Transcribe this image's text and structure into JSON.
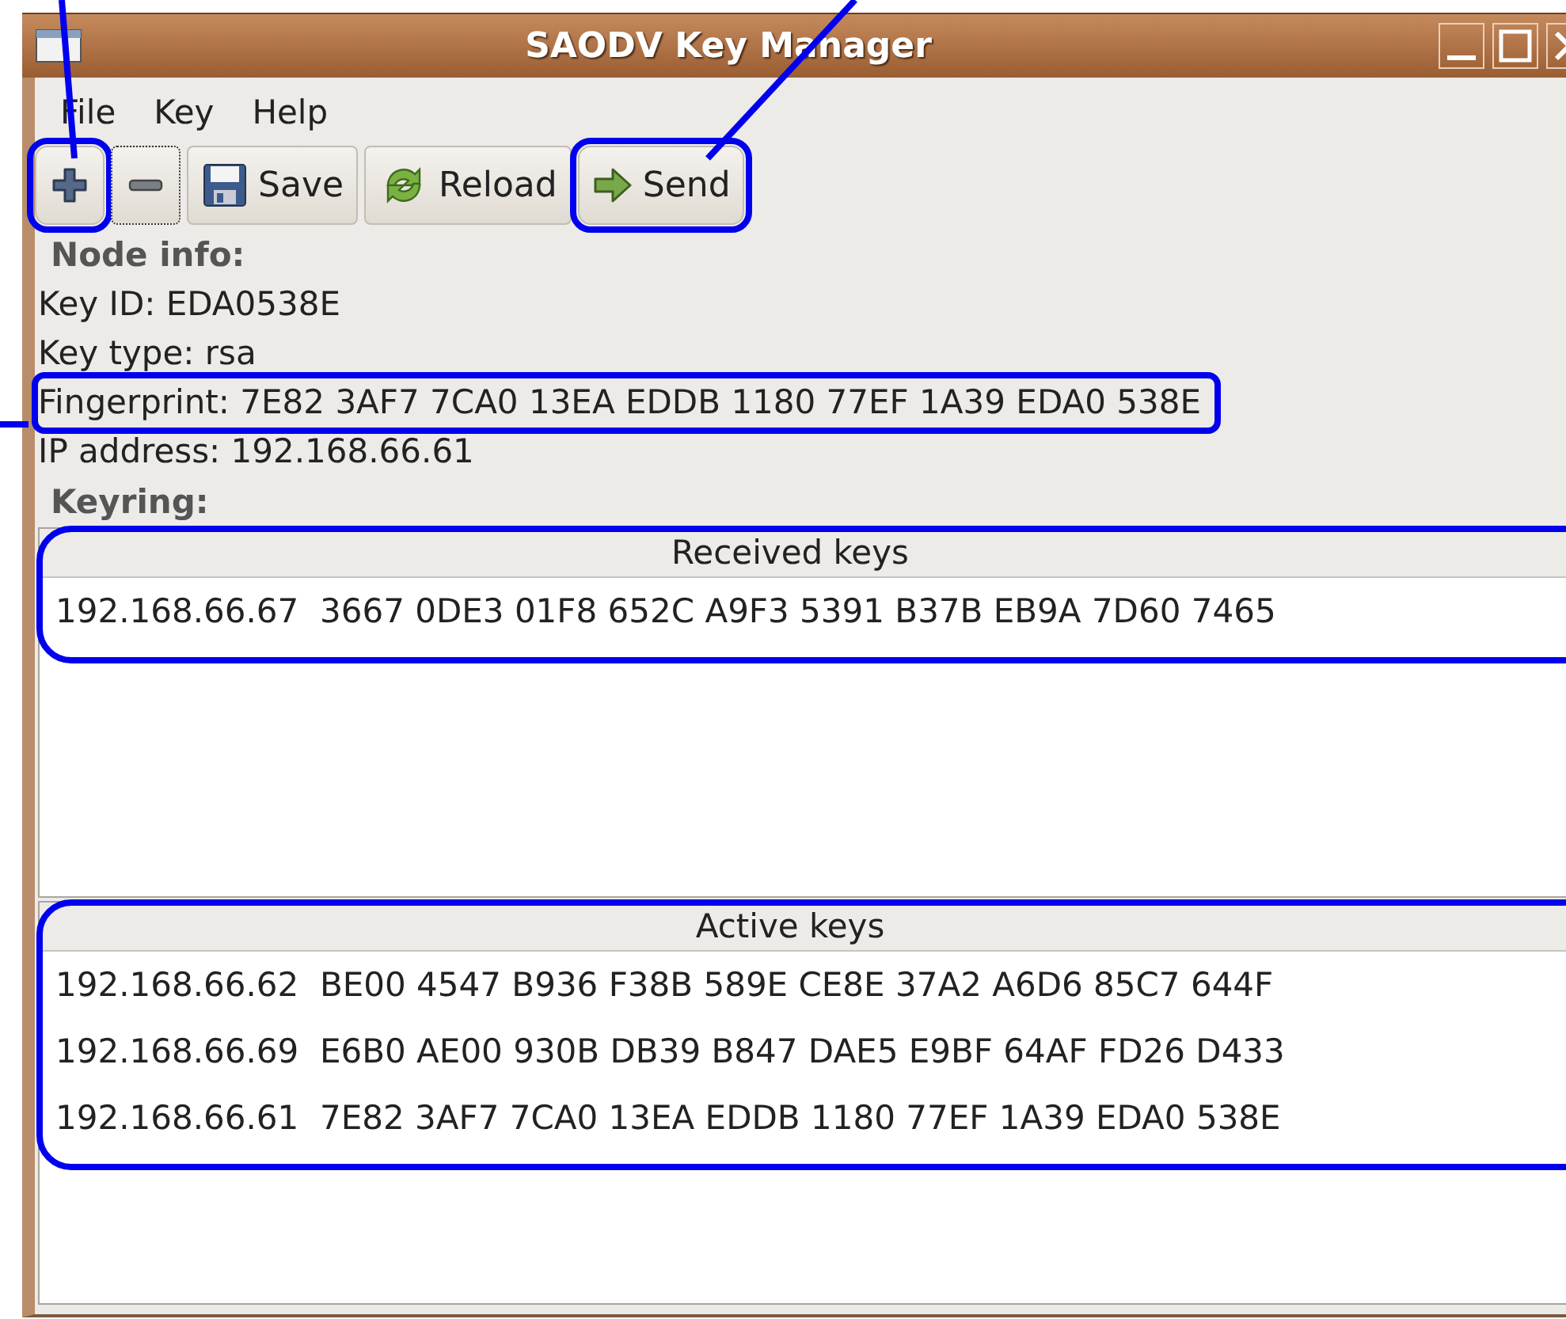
{
  "window": {
    "title": "SAODV Key Manager"
  },
  "menu": [
    {
      "label": "File"
    },
    {
      "label": "Key"
    },
    {
      "label": "Help"
    }
  ],
  "toolbar": [
    {
      "kind": "add",
      "highlighted": true,
      "focused": false
    },
    {
      "kind": "remove",
      "highlighted": false,
      "focused": true
    },
    {
      "kind": "save",
      "label": "Save",
      "highlighted": false,
      "focused": false
    },
    {
      "kind": "reload",
      "label": "Reload",
      "highlighted": false,
      "focused": false
    },
    {
      "kind": "send",
      "label": "Send",
      "highlighted": true,
      "focused": false
    }
  ],
  "node_info": {
    "heading": "Node info:",
    "lines": [
      {
        "text": "Key ID: EDA0538E",
        "highlighted": false
      },
      {
        "text": "Key type: rsa",
        "highlighted": false
      },
      {
        "text": "Fingerprint: 7E82 3AF7 7CA0 13EA EDDB 1180 77EF 1A39 EDA0 538E",
        "highlighted": true
      },
      {
        "text": "IP address: 192.168.66.61",
        "highlighted": false
      }
    ]
  },
  "keyring": {
    "heading": "Keyring:",
    "lists": [
      {
        "title": "Received keys",
        "highlighted": true,
        "rows": [
          {
            "text": "192.168.66.67  3667 0DE3 01F8 652C A9F3 5391 B37B EB9A 7D60 7465"
          }
        ]
      },
      {
        "title": "Active keys",
        "highlighted": true,
        "rows": [
          {
            "text": "192.168.66.62  BE00 4547 B936 F38B 589E CE8E 37A2 A6D6 85C7 644F"
          },
          {
            "text": "192.168.66.69  E6B0 AE00 930B DB39 B847 DAE5 E9BF 64AF FD26 D433"
          },
          {
            "text": "192.168.66.61  7E82 3AF7 7CA0 13EA EDDB 1180 77EF 1A39 EDA0 538E"
          }
        ]
      }
    ]
  }
}
